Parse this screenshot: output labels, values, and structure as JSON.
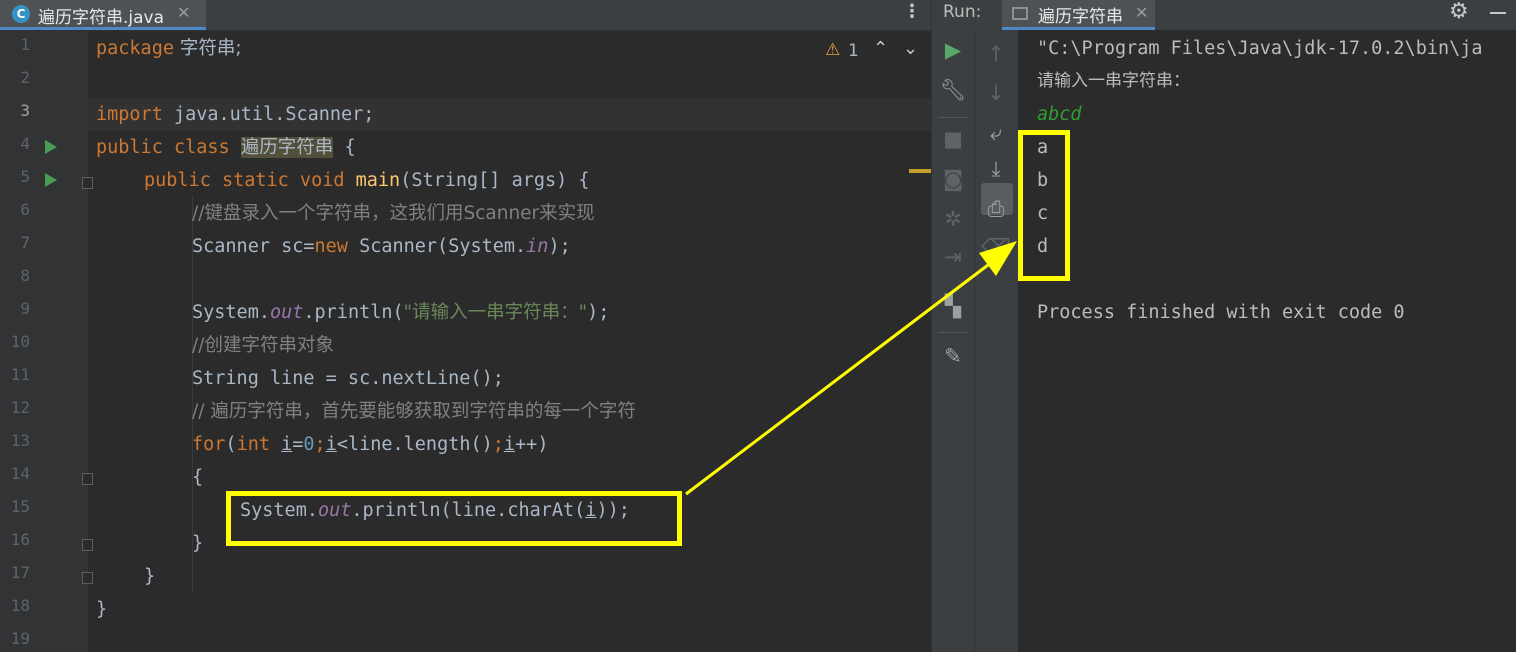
{
  "editor": {
    "tab": {
      "icon": "java-class-icon",
      "icon_letter": "C",
      "filename": "遍历字符串.java",
      "close": "✕"
    },
    "more": "⋮",
    "inspections": {
      "warning_count": "1",
      "up": "⌃",
      "down": "⌄"
    },
    "line_numbers": [
      "1",
      "2",
      "3",
      "4",
      "5",
      "6",
      "7",
      "8",
      "9",
      "10",
      "11",
      "12",
      "13",
      "14",
      "15",
      "16",
      "17",
      "18",
      "19"
    ],
    "current_line": "3",
    "code": {
      "l1": {
        "package_kw": "package",
        "package_name": " 字符串;"
      },
      "l3": {
        "import_kw": "import",
        "import_path": " java.util.Scanner;"
      },
      "l4": {
        "public_kw": "public class",
        "class_name": "遍历字符串",
        "brace": " {"
      },
      "l5": {
        "modifiers": "public static void",
        "method": "main",
        "params": "(String[] args) {"
      },
      "l6": {
        "comment": "//键盘录入一个字符串，这我们用Scanner来实现"
      },
      "l7": {
        "a": "Scanner sc=",
        "new_kw": "new",
        "b": " Scanner(System.",
        "field": "in",
        "c": ");"
      },
      "l9": {
        "a": "System.",
        "field": "out",
        "b": ".println(",
        "str": "\"请输入一串字符串：\"",
        "c": ");"
      },
      "l10": {
        "comment": "//创建字符串对象"
      },
      "l11": {
        "a": "String line = sc.nextLine();"
      },
      "l12": {
        "comment": "// 遍历字符串，首先要能够获取到字符串的每一个字符"
      },
      "l13": {
        "for_kw": "for",
        "p1": "(",
        "int_kw": "int",
        "sp": " ",
        "i1": "i",
        "eq": "=",
        "zero": "0",
        "semi1": ";",
        "i2": "i",
        "cond": "<line.length()",
        "semi2": ";",
        "i3": "i",
        "inc": "++)"
      },
      "l14": {
        "brace": "{"
      },
      "l15": {
        "a": "System.",
        "field": "out",
        "b": ".println(line.charAt(",
        "i": "i",
        "c": "));"
      },
      "l16": {
        "brace": "}"
      },
      "l17": {
        "brace": "}"
      },
      "l18": {
        "brace": "}"
      }
    }
  },
  "run": {
    "label": "Run:",
    "tab": {
      "name": "遍历字符串",
      "close": "✕"
    },
    "console": {
      "command": "\"C:\\Program Files\\Java\\jdk-17.0.2\\bin\\ja",
      "prompt": "请输入一串字符串：",
      "input": "abcd",
      "outputs": [
        "a",
        "b",
        "c",
        "d"
      ],
      "exit": "Process finished with exit code 0"
    }
  },
  "colors": {
    "annotation": "#ffff00",
    "keyword": "#cc7832",
    "string": "#6a8759",
    "method": "#ffc66d",
    "static_field": "#9876aa",
    "number": "#6897bb",
    "comment": "#808080",
    "run_green": "#499c54"
  }
}
